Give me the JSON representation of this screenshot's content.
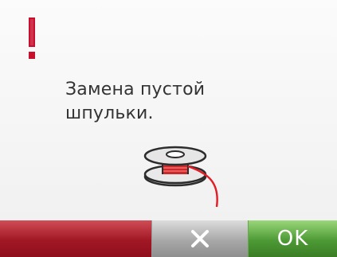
{
  "message": {
    "text": "Замена пустой\nшпульки."
  },
  "icons": {
    "warning": "exclamation-icon",
    "bobbin": "bobbin-icon",
    "cancel": "close-icon"
  },
  "buttons": {
    "ok_label": "OK"
  },
  "colors": {
    "warning": "#c8102e",
    "red_button": "#a11725",
    "cancel_button": "#a8a8a8",
    "ok_button": "#4d9a35",
    "thread": "#e31b23"
  }
}
